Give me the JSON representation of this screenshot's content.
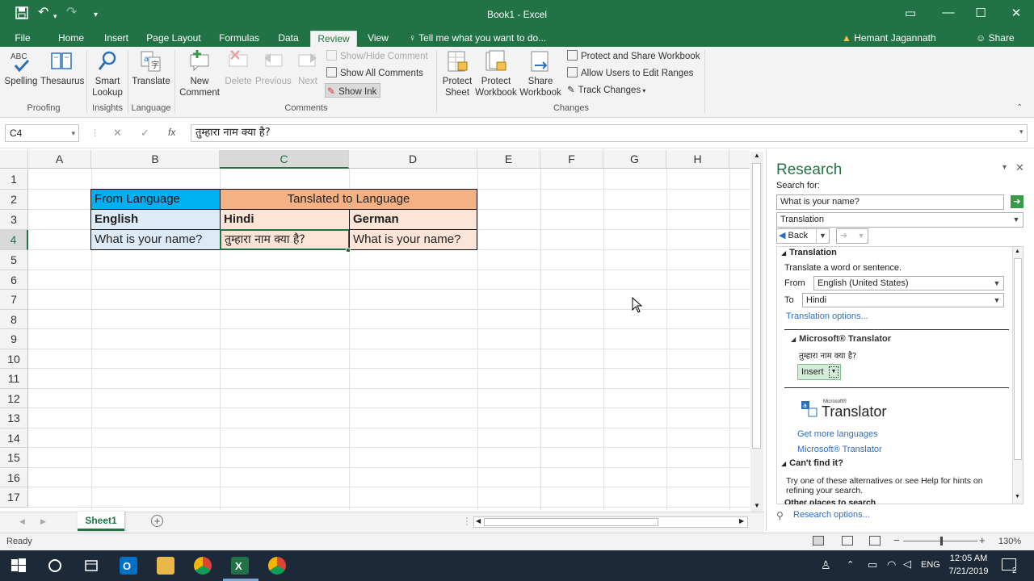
{
  "titlebar": {
    "title": "Book1  -  Excel"
  },
  "tabs": {
    "file": "File",
    "home": "Home",
    "insert": "Insert",
    "page_layout": "Page Layout",
    "formulas": "Formulas",
    "data": "Data",
    "review": "Review",
    "view": "View",
    "tellme": "Tell me what you want to do...",
    "user": "Hemant Jagannath Khapre",
    "share": "Share"
  },
  "ribbon": {
    "spelling": "Spelling",
    "thesaurus": "Thesaurus",
    "smart1": "Smart",
    "smart2": "Lookup",
    "translate": "Translate",
    "new1": "New",
    "new2": "Comment",
    "delete": "Delete",
    "previous": "Previous",
    "next": "Next",
    "show_hide": "Show/Hide Comment",
    "show_all": "Show All Comments",
    "show_ink": "Show Ink",
    "protect_sheet1": "Protect",
    "protect_sheet2": "Sheet",
    "protect_wb1": "Protect",
    "protect_wb2": "Workbook",
    "share_wb1": "Share",
    "share_wb2": "Workbook",
    "protect_share": "Protect and Share Workbook",
    "allow_users": "Allow Users to Edit Ranges",
    "track": "Track Changes",
    "g_proofing": "Proofing",
    "g_insights": "Insights",
    "g_language": "Language",
    "g_comments": "Comments",
    "g_changes": "Changes",
    "abc": "ABC"
  },
  "formula": {
    "namebox": "C4",
    "content": "तुम्हारा नाम क्या है?",
    "fx": "fx"
  },
  "grid": {
    "columns": [
      "A",
      "B",
      "C",
      "D",
      "E",
      "F",
      "G",
      "H"
    ],
    "rows": [
      "1",
      "2",
      "3",
      "4",
      "5",
      "6",
      "7",
      "8",
      "9",
      "10",
      "11",
      "12",
      "13",
      "14",
      "15",
      "16",
      "17"
    ],
    "b2": "From Language",
    "c2": "Tanslated to Language",
    "b3": "English",
    "c3": "Hindi",
    "d3": "German",
    "b4": "What is your name?",
    "c4": "तुम्हारा नाम क्या है?",
    "d4": "What is your name?"
  },
  "research": {
    "title": "Research",
    "search_for": "Search for:",
    "query": "What is your name?",
    "service": "Translation",
    "back": "Back",
    "sec_translation": "Translation",
    "translate_desc": "Translate a word or sentence.",
    "from_label": "From",
    "from_value": "English (United States)",
    "to_label": "To",
    "to_value": "Hindi",
    "options": "Translation options...",
    "ms_translator": "Microsoft® Translator",
    "result": "तुम्हारा नाम क्या है?",
    "insert": "Insert",
    "logo_small": "Microsoft®",
    "logo_big": "Translator",
    "more_lang": "Get more languages",
    "ms_link": "Microsoft® Translator",
    "cant_find": "Can't find it?",
    "help_text": "Try one of these alternatives or see Help for hints on refining your search.",
    "other_places": "Other places to search",
    "research_options": "Research options..."
  },
  "sheets": {
    "sheet1": "Sheet1"
  },
  "status": {
    "ready": "Ready",
    "zoom": "130%"
  },
  "taskbar": {
    "time": "12:05 AM",
    "date": "7/21/2019",
    "lang": "ENG",
    "notif": "2"
  },
  "colors": {
    "excel_green": "#217346",
    "orange": "#f4b183",
    "light_orange": "#fce4d6",
    "blue": "#00b0f0",
    "light_blue": "#ddebf7"
  }
}
